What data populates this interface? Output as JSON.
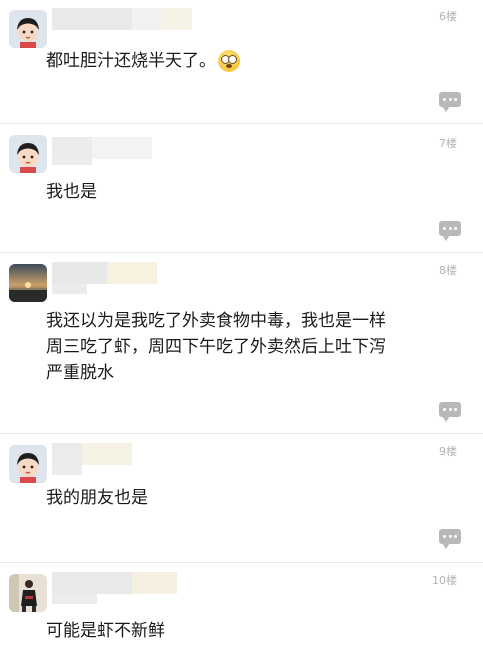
{
  "posts": [
    {
      "floor": "6楼",
      "avatar": "cartoon-girl",
      "text_lines": [
        "都吐胆汁还烧半天了。"
      ],
      "emoji": "flushed-face"
    },
    {
      "floor": "7楼",
      "avatar": "cartoon-girl",
      "text_lines": [
        "我也是"
      ]
    },
    {
      "floor": "8楼",
      "avatar": "sunset-photo",
      "text_lines": [
        "我还以为是我吃了外卖食物中毒，我也是一样",
        "周三吃了虾，周四下午吃了外卖然后上吐下泻",
        "严重脱水"
      ]
    },
    {
      "floor": "9楼",
      "avatar": "cartoon-girl",
      "text_lines": [
        "我的朋友也是"
      ]
    },
    {
      "floor": "10楼",
      "avatar": "person-photo",
      "text_lines": [
        "可能是虾不新鲜"
      ]
    }
  ],
  "colors": {
    "text": "#1a1a1a",
    "floor": "#b3b3b3",
    "divider": "#e6e6e6",
    "reply_icon": "#b8b8b8"
  },
  "icons": {
    "reply": "comment-bubble-icon"
  }
}
